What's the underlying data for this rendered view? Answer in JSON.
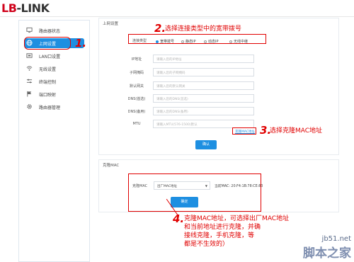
{
  "brand": {
    "logo_text_red": "LB",
    "logo_text_dark": "-LINK"
  },
  "sidebar": {
    "items": [
      {
        "label": "路由器状态",
        "icon": "monitor-icon"
      },
      {
        "label": "上网设置",
        "icon": "globe-icon",
        "active": true
      },
      {
        "label": "LAN口设置",
        "icon": "lan-icon"
      },
      {
        "label": "无线设置",
        "icon": "wifi-icon"
      },
      {
        "label": "终端控制",
        "icon": "sliders-icon"
      },
      {
        "label": "端口映射",
        "icon": "flag-icon"
      },
      {
        "label": "路由器管理",
        "icon": "gear-icon"
      }
    ]
  },
  "internet": {
    "title": "上网设置",
    "conn_type_label": "连接类型",
    "conn_types": [
      "宽带拨号",
      "静态IP",
      "动态IP",
      "无线中继"
    ],
    "fields": [
      {
        "label": "IP地址",
        "placeholder": "请输入您的IP地址"
      },
      {
        "label": "子网掩码",
        "placeholder": "请输入您的子网掩码"
      },
      {
        "label": "默认网关",
        "placeholder": "请输入您的默认网关"
      },
      {
        "label": "DNS(首选)",
        "placeholder": "请输入您的DNS(首选)"
      },
      {
        "label": "DNS(备用)",
        "placeholder": "请输入您的DNS(备用)"
      },
      {
        "label": "MTU",
        "placeholder": "请输入MTU(576-1500)默认"
      }
    ],
    "clone_mac_link": "克隆MAC地址",
    "confirm": "确认"
  },
  "mac_clone": {
    "title": "克隆MAC",
    "label": "克隆MAC",
    "select_value": "出厂MAC地址",
    "current_mac": "当前MAC: 20:F4:1B:78:CE:83",
    "confirm": "确定"
  },
  "annotations": {
    "n1": "1.",
    "n2": "2.",
    "t2": "选择连接类型中的宽带拨号",
    "n3": "3.",
    "t3": "选择克隆MAC地址",
    "n4": "4.",
    "t4_l1": "克隆MAC地址，可选择出厂MAC地址",
    "t4_l2": "和当前地址进行克隆，并确",
    "t4_l3": "接线克隆，手机克隆，等",
    "t4_l4": "都是不生效的）"
  },
  "watermark": {
    "site": "jb51.net",
    "cn": "脚本之家"
  },
  "colors": {
    "accent": "#1e8fe1",
    "annotation": "#e00000",
    "brand_red": "#d0021b"
  }
}
